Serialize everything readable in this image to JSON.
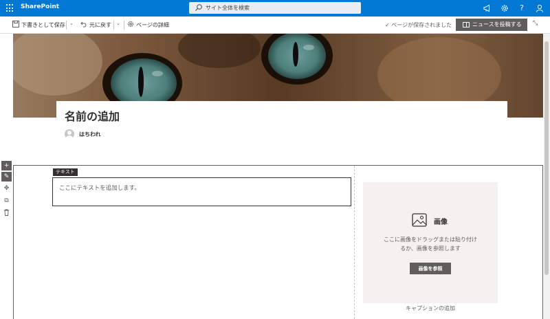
{
  "suite": {
    "app_name": "SharePoint",
    "search_placeholder": "サイト全体を検索",
    "icons": [
      "waffle-icon",
      "megaphone-icon",
      "gear-icon",
      "help-icon",
      "person-icon"
    ],
    "help_glyph": "?"
  },
  "commandbar": {
    "save_draft": "下書きとして保存",
    "undo": "元に戻す",
    "page_details": "ページの詳細",
    "saved_status": "ページが保存されました",
    "post_news": "ニュースを投稿する"
  },
  "header": {
    "title": "名前の追加",
    "author": "はちわれ"
  },
  "text_webpart": {
    "tag": "テキスト",
    "placeholder": "ここにテキストを追加します。"
  },
  "image_webpart": {
    "label": "画像",
    "help": "ここに画像をドラッグまたは貼り付けるか、画像を参照します",
    "browse_button": "画像を参照",
    "caption": "キャプションの追加"
  },
  "colors": {
    "suite_bar": "#0078d4",
    "button_gray": "#605e5c",
    "text": "#323130"
  }
}
